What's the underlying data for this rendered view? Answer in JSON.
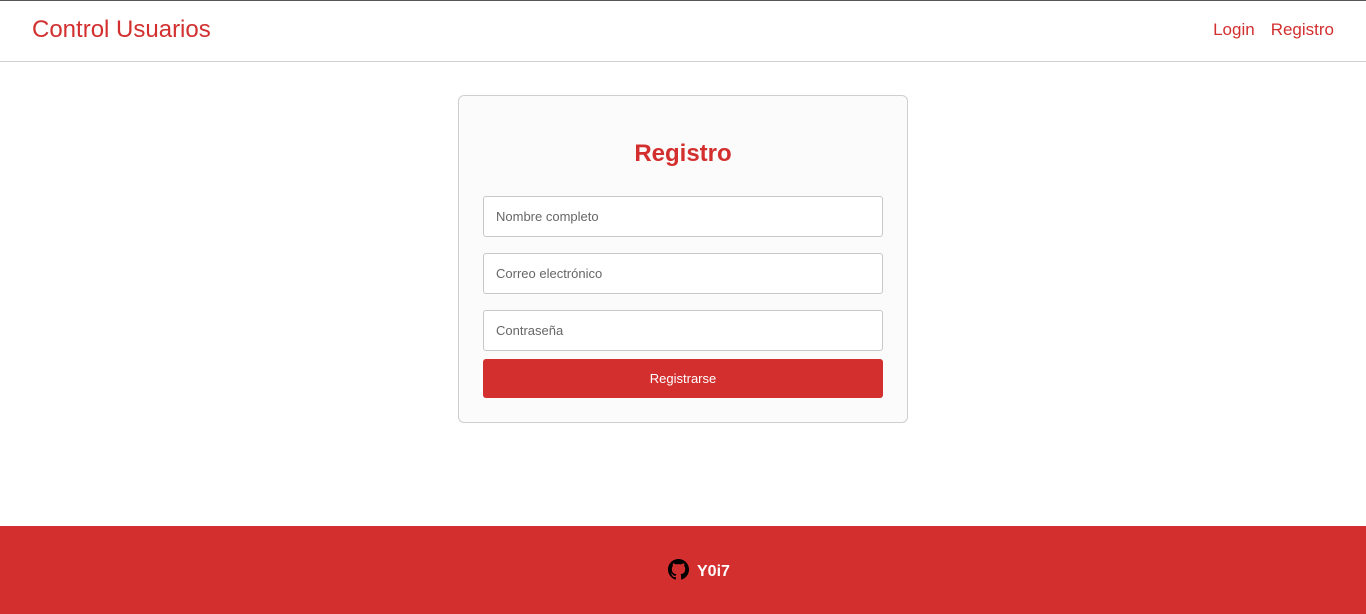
{
  "header": {
    "brand": "Control Usuarios",
    "nav": {
      "login": "Login",
      "registro": "Registro"
    }
  },
  "form": {
    "title": "Registro",
    "fields": {
      "name_placeholder": "Nombre completo",
      "email_placeholder": "Correo electrónico",
      "password_placeholder": "Contraseña"
    },
    "submit_label": "Registrarse"
  },
  "footer": {
    "icon": "github-icon",
    "username": "Y0i7"
  },
  "colors": {
    "accent": "#d32f2f",
    "card_bg": "#fbfbfb",
    "border": "#cfcfcf"
  }
}
